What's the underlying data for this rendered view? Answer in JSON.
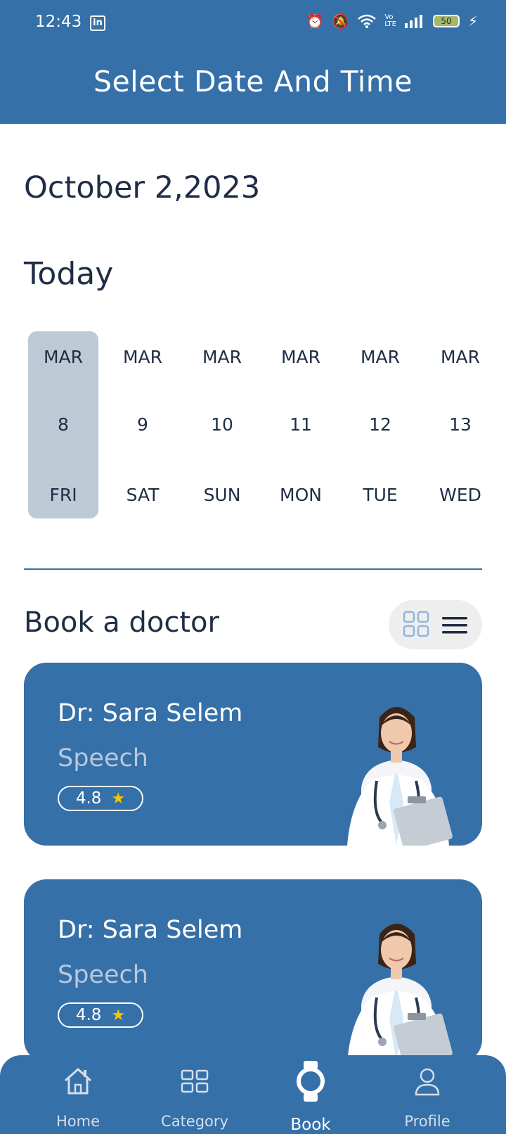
{
  "status_bar": {
    "time": "12:43",
    "battery": "50"
  },
  "header": {
    "title": "Select Date And Time"
  },
  "date_label": "October 2,2023",
  "today_label": "Today",
  "days": [
    {
      "month": "MAR",
      "day": "8",
      "weekday": "FRI",
      "selected": true
    },
    {
      "month": "MAR",
      "day": "9",
      "weekday": "SAT",
      "selected": false
    },
    {
      "month": "MAR",
      "day": "10",
      "weekday": "SUN",
      "selected": false
    },
    {
      "month": "MAR",
      "day": "11",
      "weekday": "MON",
      "selected": false
    },
    {
      "month": "MAR",
      "day": "12",
      "weekday": "TUE",
      "selected": false
    },
    {
      "month": "MAR",
      "day": "13",
      "weekday": "WED",
      "selected": false
    }
  ],
  "book_section": {
    "title": "Book a doctor"
  },
  "doctors": [
    {
      "name": "Dr: Sara Selem",
      "specialty": "Speech",
      "rating": "4.8"
    },
    {
      "name": "Dr: Sara Selem",
      "specialty": "Speech",
      "rating": "4.8"
    }
  ],
  "nav": [
    {
      "label": "Home",
      "icon": "home-icon"
    },
    {
      "label": "Category",
      "icon": "category-icon"
    },
    {
      "label": "Book",
      "icon": "watch-icon",
      "active": true
    },
    {
      "label": "Profile",
      "icon": "profile-icon"
    }
  ],
  "colors": {
    "primary": "#3570a8",
    "selected_day": "#bec9d6",
    "text_dark": "#1f2d45",
    "star": "#f7c600"
  }
}
